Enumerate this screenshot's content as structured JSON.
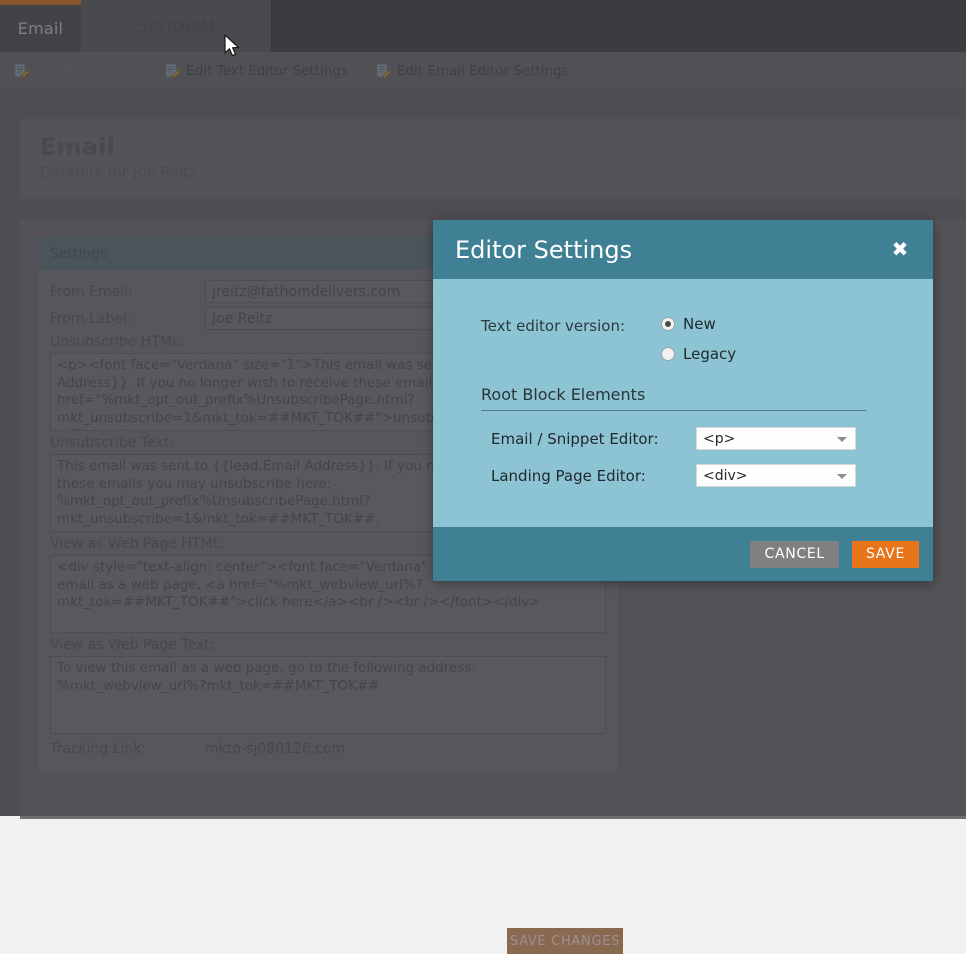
{
  "tabs": [
    {
      "label": "Email",
      "active": true
    },
    {
      "label": "SPF/DKIM",
      "active": false
    }
  ],
  "toolbar": {
    "actions": [
      {
        "label": "Edit IP Settings",
        "icon": "edit-document-icon",
        "disabled": true
      },
      {
        "label": "Edit Text Editor Settings",
        "icon": "edit-document-icon",
        "disabled": false
      },
      {
        "label": "Edit Email Editor Settings",
        "icon": "edit-document-icon",
        "disabled": false
      }
    ]
  },
  "page": {
    "title": "Email",
    "subtitle": "Defaults for Joe Reitz"
  },
  "settings": {
    "panel_title": "Settings",
    "from_email_label": "From Email:",
    "from_email_value": "jreitz@fathomdelivers.com",
    "from_label_label": "From Label:",
    "from_label_value": "Joe Reitz",
    "unsubscribe_html_label": "Unsubscribe HTML:",
    "unsubscribe_html_value": "<p><font face=\"Verdana\" size=\"1\">This email was sent to {{lead.Email Address}}. If you no longer wish to receive these emails you may <a href=\"%mkt_opt_out_prefix%UnsubscribePage.html?mkt_unsubscribe=1&mkt_tok=##MKT_TOK##\">unsubscribe here</a>.</font></p>",
    "unsubscribe_text_label": "Unsubscribe Text:",
    "unsubscribe_text_value": "This email was sent to {{lead.Email Address}}. If you no longer wish to receive these emails you may unsubscribe here: %mkt_opt_out_prefix%UnsubscribePage.html?mkt_unsubscribe=1&mkt_tok=##MKT_TOK##.",
    "webpage_html_label": "View as Web Page HTML:",
    "webpage_html_value": "<div style=\"text-align: center\"><font face=\"Verdana\" size=\"1\">To view this email as a web page, <a href=\"%mkt_webview_url%?mkt_tok=##MKT_TOK##\">click here</a><br /><br /></font></div>",
    "webpage_text_label": "View as Web Page Text:",
    "webpage_text_value": "To view this email as a web page, go to the following address:\n%mkt_webview_url%?mkt_tok=##MKT_TOK##",
    "tracking_link_label": "Tracking Link:",
    "tracking_link_value": "mkto-sj080126.com",
    "save_changes_label": "SAVE CHANGES"
  },
  "modal": {
    "title": "Editor Settings",
    "close_icon": "close-icon",
    "text_editor_version_label": "Text editor version:",
    "version_options": [
      {
        "label": "New",
        "selected": true
      },
      {
        "label": "Legacy",
        "selected": false
      }
    ],
    "section_heading": "Root Block Elements",
    "email_snippet_label": "Email / Snippet Editor:",
    "email_snippet_value": "<p>",
    "landing_page_label": "Landing Page Editor:",
    "landing_page_value": "<div>",
    "cancel_label": "CANCEL",
    "save_label": "SAVE"
  },
  "colors": {
    "accent_orange": "#e8751a",
    "modal_header_teal": "#3f8095",
    "modal_body_blue": "#8cc4d4",
    "cancel_gray": "#808080"
  }
}
